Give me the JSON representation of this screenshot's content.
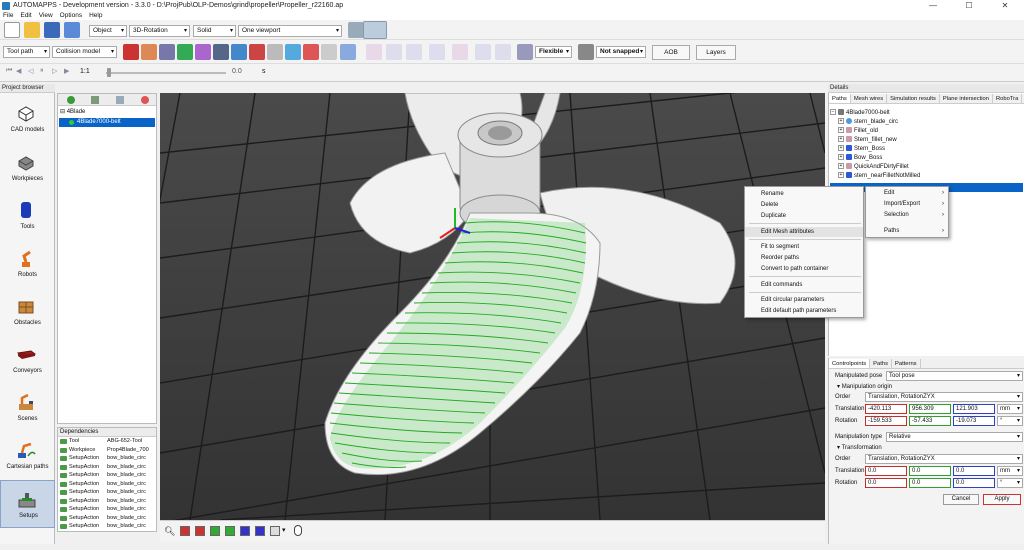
{
  "window": {
    "title": "AUTOMAPPS - Development version - 3.3.0 - D:\\ProjPub\\OLP-Demos\\grind\\propeller\\Propeller_r22160.ap",
    "controls": [
      "—",
      "☐",
      "✕"
    ]
  },
  "menu": [
    "File",
    "Edit",
    "View",
    "Options",
    "Help"
  ],
  "toolbar1": {
    "object": "Object",
    "rotation": "3D-Rotation",
    "shading": "Solid",
    "viewport": "One viewport"
  },
  "toolbar2": {
    "tool_path": "Tool path",
    "collision_model": "Collision model",
    "flexible": "Flexible",
    "not_snapped": "Not snapped",
    "aob": "AOB",
    "layers": "Layers"
  },
  "toolbar3": {
    "speed": "1:1",
    "time_value": "0.0",
    "unit": "s"
  },
  "project_browser": {
    "title": "Project browser",
    "items": [
      {
        "label": "CAD models",
        "icon": "cad-models-icon"
      },
      {
        "label": "Workpieces",
        "icon": "workpieces-icon"
      },
      {
        "label": "Tools",
        "icon": "tools-icon"
      },
      {
        "label": "Robots",
        "icon": "robots-icon"
      },
      {
        "label": "Obstacles",
        "icon": "obstacles-icon"
      },
      {
        "label": "Conveyors",
        "icon": "conveyors-icon"
      },
      {
        "label": "Scenes",
        "icon": "scenes-icon"
      },
      {
        "label": "Cartesian paths",
        "icon": "cartesian-paths-icon"
      },
      {
        "label": "Setups",
        "icon": "setups-icon"
      }
    ]
  },
  "tree": {
    "root": "4Blade",
    "child": "4Blade7000-belt"
  },
  "dependencies": {
    "title": "Dependencies",
    "rows": [
      {
        "type": "Tool",
        "name": "ABG-652-Tool"
      },
      {
        "type": "Workpiece",
        "name": "Prop4Blade_700"
      },
      {
        "type": "SetupAction",
        "name": "bow_blade_circ"
      },
      {
        "type": "SetupAction",
        "name": "bow_blade_circ"
      },
      {
        "type": "SetupAction",
        "name": "bow_blade_circ"
      },
      {
        "type": "SetupAction",
        "name": "bow_blade_circ"
      },
      {
        "type": "SetupAction",
        "name": "bow_blade_circ"
      },
      {
        "type": "SetupAction",
        "name": "bow_blade_circ"
      },
      {
        "type": "SetupAction",
        "name": "bow_blade_circ"
      },
      {
        "type": "SetupAction",
        "name": "bow_blade_circ"
      },
      {
        "type": "SetupAction",
        "name": "bow_blade_circ"
      }
    ]
  },
  "context_menu": {
    "items": [
      "Rename",
      "Delete",
      "Duplicate",
      "Edit Mesh attributes",
      "Fit to segment",
      "Reorder paths",
      "Convert to path container",
      "Edit commands",
      "Edit circular parameters",
      "Edit default path parameters"
    ],
    "highlighted": "Edit Mesh attributes"
  },
  "submenu": {
    "items": [
      "Edit",
      "Import/Export",
      "Selection",
      "Paths"
    ]
  },
  "details": {
    "title": "Details",
    "tabs": [
      "Paths",
      "Mesh wires",
      "Simulation results",
      "Plane intersection",
      "RoboTra"
    ],
    "tree_root": "4Blade7000-belt",
    "tree_items": [
      "stern_blade_circ",
      "Fillet_old",
      "Stern_fillet_new",
      "Stern_Boss",
      "Bow_Boss",
      "QuickAndFDirtyFillet",
      "stern_nearFilletNotMilled"
    ]
  },
  "props": {
    "tabs": [
      "Controlpoints",
      "Paths",
      "Patterns"
    ],
    "manipulated_pose_label": "Manipulated pose",
    "manipulated_pose": "Tool pose",
    "origin_section": "Manipulation origin",
    "order_label": "Order",
    "order_value": "Translation, RotationZYX",
    "translation_label": "Translation",
    "translation": [
      "-420.113",
      "956.309",
      "121.903"
    ],
    "translation_unit": "mm",
    "rotation_label": "Rotation",
    "rotation": [
      "-159.533",
      "-57.433",
      "-19.073"
    ],
    "rotation_unit": "°",
    "manip_type_label": "Manipulation type",
    "manip_type": "Relative",
    "transform_section": "Transformation",
    "t_order_label": "Order",
    "t_order_value": "Translation, RotationZYX",
    "t_translation_label": "Translation",
    "t_translation": [
      "0.0",
      "0.0",
      "0.0"
    ],
    "t_translation_unit": "mm",
    "t_rotation_label": "Rotation",
    "t_rotation": [
      "0.0",
      "0.0",
      "0.0"
    ],
    "t_rotation_unit": "°",
    "cancel": "Cancel",
    "apply": "Apply"
  }
}
